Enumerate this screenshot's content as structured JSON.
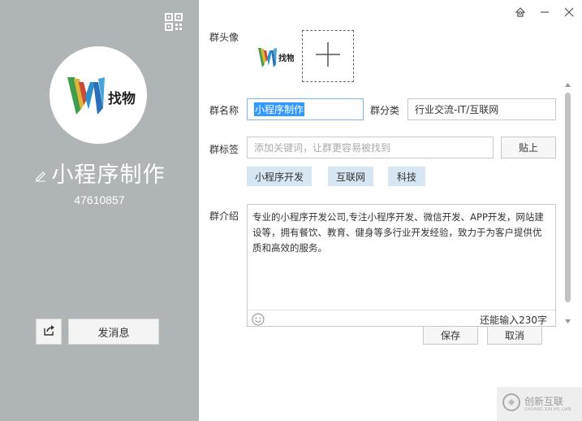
{
  "profile": {
    "group_name": "小程序制作",
    "group_id": "47610857",
    "logo_letter": "W",
    "logo_text": "找物",
    "send_message_label": "发消息"
  },
  "form": {
    "avatar_label": "群头像",
    "name_label": "群名称",
    "name_value": "小程序制作",
    "category_label": "群分类",
    "category_value": "行业交流-IT/互联网",
    "tags_label": "群标签",
    "tags_placeholder": "添加关键词，让群更容易被找到",
    "paste_label": "贴上",
    "tags": [
      "小程序开发",
      "互联网",
      "科技"
    ],
    "intro_label": "群介绍",
    "intro_text": "专业的小程序开发公司,专注小程序开发、微信开发、APP开发，网站建设等，拥有餐饮、教育、健身等多行业开发经验，致力于为客户提供优质和高效的服务。",
    "remaining": "还能输入230字"
  },
  "actions": {
    "save_label": "保存",
    "cancel_label": "取消"
  },
  "watermark": {
    "text": "创新互联",
    "sub": "CHUANG XIN HU LIAN"
  },
  "icons": {
    "qr": "qr-code-icon",
    "edit": "pencil-icon",
    "share": "share-icon",
    "skin": "skin-icon",
    "minimize": "minimize-icon",
    "close": "close-icon",
    "add": "plus-icon",
    "emoji": "smiley-icon"
  },
  "colors": {
    "left_panel": "#afb4b7",
    "tag_bg": "#d6e6f3",
    "selection": "#3399ff"
  }
}
